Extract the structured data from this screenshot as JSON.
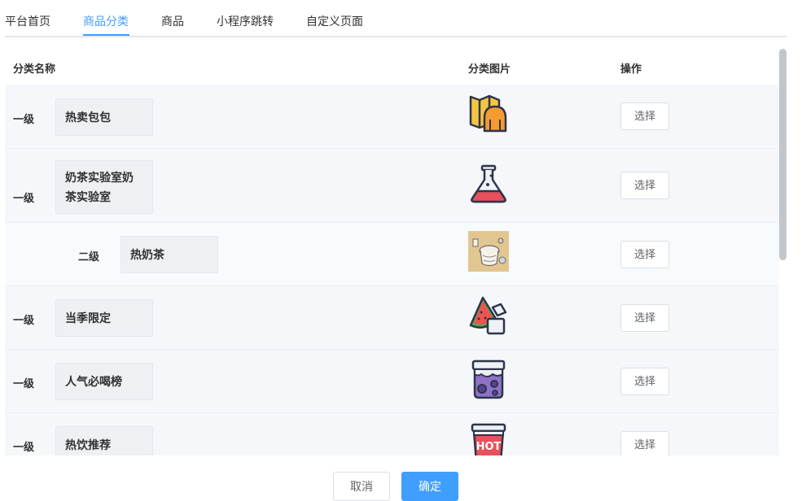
{
  "tabs": [
    {
      "label": "平台首页"
    },
    {
      "label": "商品分类"
    },
    {
      "label": "商品"
    },
    {
      "label": "小程序跳转"
    },
    {
      "label": "自定义页面"
    }
  ],
  "active_tab": "商品分类",
  "table": {
    "headers": {
      "name": "分类名称",
      "image": "分类图片",
      "action": "操作"
    },
    "rows": [
      {
        "level": "一级",
        "name": "热卖包包",
        "icon": "map-bread-icon",
        "action": "选择"
      },
      {
        "level": "一级",
        "name": "奶茶实验室奶茶实验室",
        "icon": "flask-icon",
        "action": "选择"
      },
      {
        "level": "二级",
        "name": "热奶茶",
        "icon": "milk-tea-photo",
        "action": "选择"
      },
      {
        "level": "一级",
        "name": "当季限定",
        "icon": "watermelon-icon",
        "action": "选择"
      },
      {
        "level": "一级",
        "name": "人气必喝榜",
        "icon": "bubble-tea-jar-icon",
        "action": "选择"
      },
      {
        "level": "一级",
        "name": "热饮推荐",
        "icon": "hot-cup-icon",
        "action": "选择"
      }
    ]
  },
  "footer": {
    "cancel_label": "取消",
    "confirm_label": "确定"
  },
  "colors": {
    "accent": "#409eff",
    "row_bg": "#f5f7fa",
    "input_bg": "#eef1f4"
  }
}
